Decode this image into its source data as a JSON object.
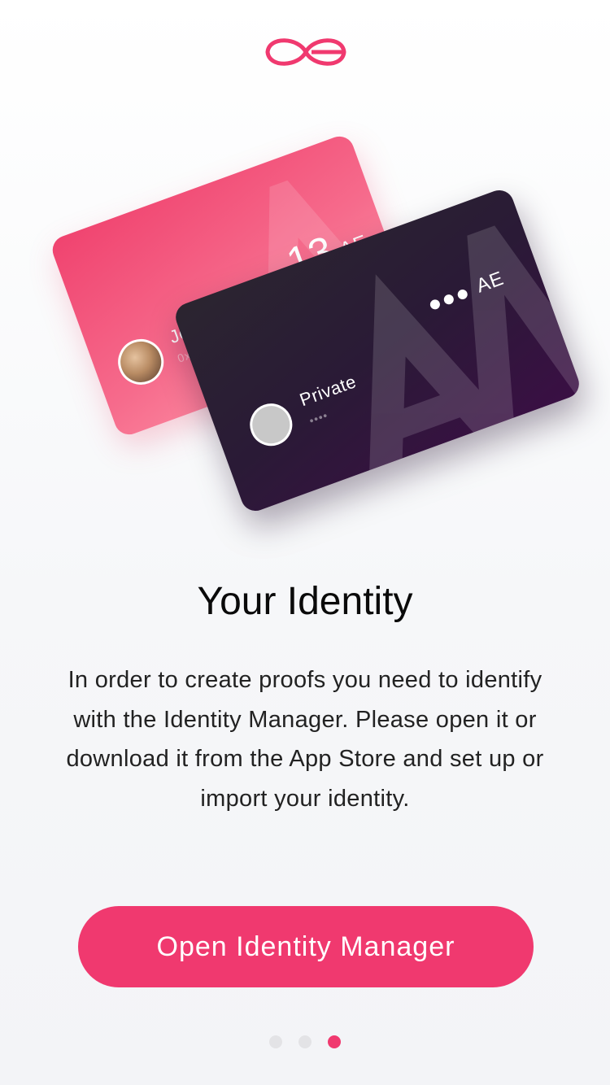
{
  "brand": {
    "logo_icon": "aeternity-logo-icon",
    "accent_color": "#f0396f"
  },
  "cards": {
    "pink": {
      "name": "Joan Work",
      "address": "0x5E6794•••",
      "amount": "13",
      "unit": "AE",
      "avatar_icon": "user-photo-avatar"
    },
    "dark": {
      "name": "Private",
      "address": "••••",
      "amount_hidden": "•••",
      "unit": "AE",
      "avatar_icon": "empty-avatar"
    }
  },
  "onboarding": {
    "title": "Your Identity",
    "description": "In order to create proofs you need to identify with the Identity Manager. Please open it or download it from the App Store and set up or import your identity.",
    "cta_label": "Open Identity Manager"
  },
  "pager": {
    "total": 3,
    "active_index": 2
  }
}
